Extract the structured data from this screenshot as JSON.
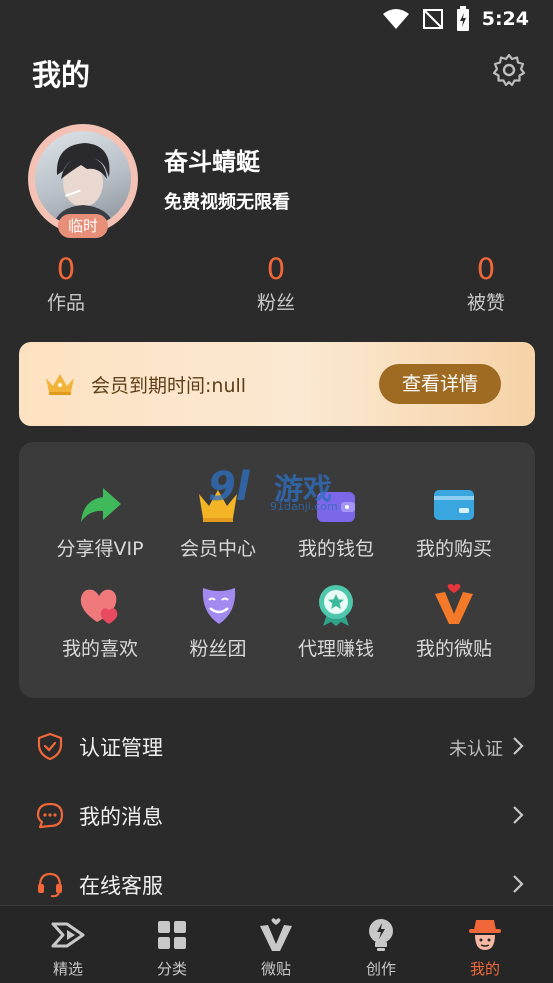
{
  "status_bar": {
    "time": "5:24"
  },
  "header": {
    "title": "我的",
    "settings_icon": "gear-icon"
  },
  "profile": {
    "username": "奋斗蜻蜓",
    "subtitle": "免费视频无限看",
    "badge": "临时"
  },
  "stats": [
    {
      "value": "0",
      "label": "作品"
    },
    {
      "value": "0",
      "label": "粉丝"
    },
    {
      "value": "0",
      "label": "被赞"
    }
  ],
  "vip": {
    "expiry_text": "会员到期时间:null",
    "button_label": "查看详情",
    "icon": "crown-icon"
  },
  "grid": [
    {
      "label": "分享得VIP",
      "icon": "share-arrow-icon"
    },
    {
      "label": "会员中心",
      "icon": "crown-icon"
    },
    {
      "label": "我的钱包",
      "icon": "wallet-icon"
    },
    {
      "label": "我的购买",
      "icon": "card-icon"
    },
    {
      "label": "我的喜欢",
      "icon": "hearts-icon"
    },
    {
      "label": "粉丝团",
      "icon": "smile-mask-icon"
    },
    {
      "label": "代理赚钱",
      "icon": "star-medal-icon"
    },
    {
      "label": "我的微贴",
      "icon": "v-heart-icon"
    }
  ],
  "watermark": {
    "big": "9l",
    "cn": "游戏",
    "url": "91danji.com"
  },
  "menu": [
    {
      "label": "认证管理",
      "value": "未认证",
      "icon": "shield-check-icon"
    },
    {
      "label": "我的消息",
      "value": "",
      "icon": "chat-bubble-icon"
    },
    {
      "label": "在线客服",
      "value": "",
      "icon": "headset-icon"
    }
  ],
  "tabs": [
    {
      "label": "精选",
      "icon": "play-icon",
      "active": false
    },
    {
      "label": "分类",
      "icon": "grid-icon",
      "active": false
    },
    {
      "label": "微贴",
      "icon": "v-heart-icon",
      "active": false
    },
    {
      "label": "创作",
      "icon": "lightbulb-icon",
      "active": false
    },
    {
      "label": "我的",
      "icon": "hat-face-icon",
      "active": true
    }
  ],
  "colors": {
    "background": "#2b2b2b",
    "accent": "#f0683a",
    "card": "#3b3b3b",
    "vip_button": "#9f6b23"
  }
}
